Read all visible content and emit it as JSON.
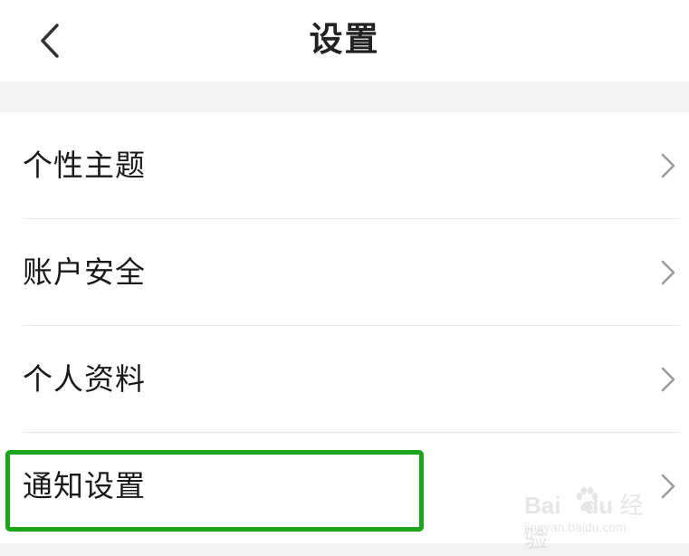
{
  "header": {
    "title": "设置",
    "back_icon": "chevron-left-icon"
  },
  "settings": {
    "items": [
      {
        "label": "个性主题",
        "icon": "chevron-right-icon"
      },
      {
        "label": "账户安全",
        "icon": "chevron-right-icon"
      },
      {
        "label": "个人资料",
        "icon": "chevron-right-icon"
      },
      {
        "label": "通知设置",
        "icon": "chevron-right-icon",
        "highlighted": true
      }
    ]
  },
  "watermark": {
    "brand": "Bai",
    "brand_suffix": "du",
    "product": "经验",
    "url": "jingyan.baidu.com"
  },
  "colors": {
    "highlight": "#1aa51a",
    "background": "#f3f3f3",
    "surface": "#ffffff",
    "text": "#1a1a1a",
    "chevron": "#9a9a9a"
  }
}
